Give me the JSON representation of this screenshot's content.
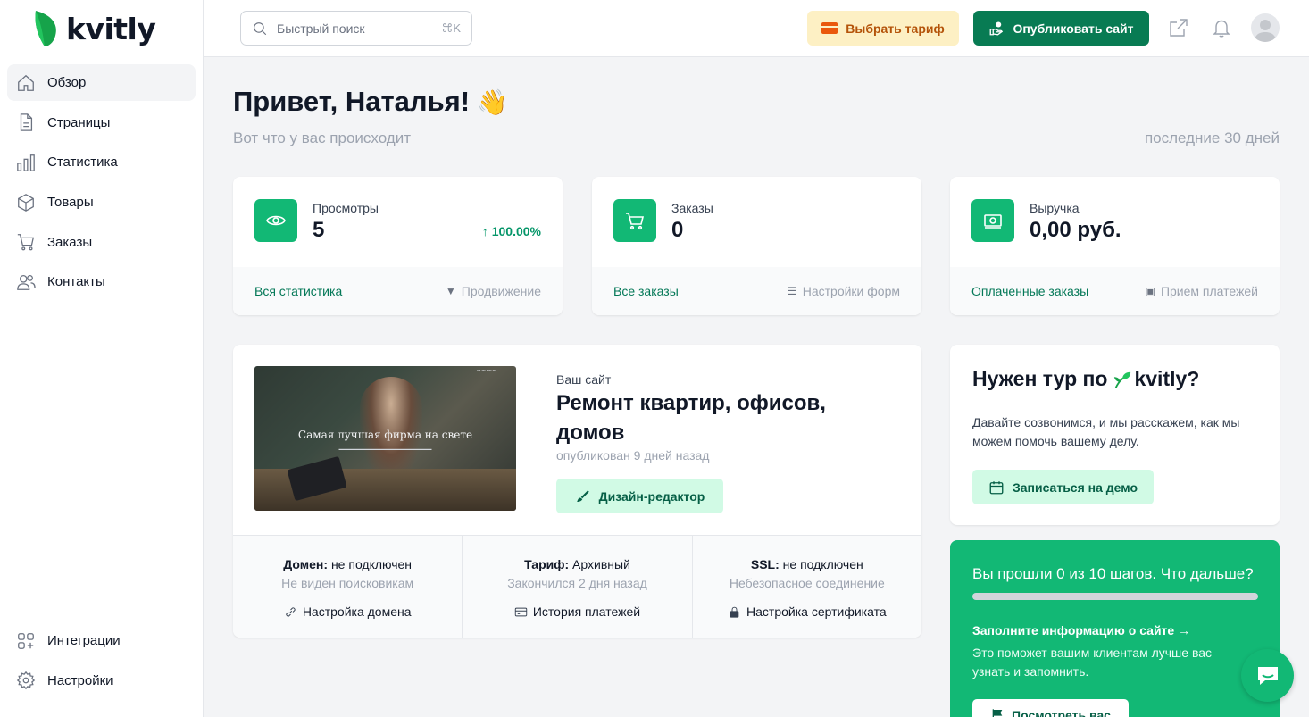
{
  "brand": {
    "name": "kvitly",
    "accent": "#12b875"
  },
  "sidebar": {
    "items": [
      {
        "label": "Обзор",
        "icon": "home-icon"
      },
      {
        "label": "Страницы",
        "icon": "document-icon"
      },
      {
        "label": "Статистика",
        "icon": "bar-chart-icon"
      },
      {
        "label": "Товары",
        "icon": "box-icon"
      },
      {
        "label": "Заказы",
        "icon": "cart-icon"
      },
      {
        "label": "Контакты",
        "icon": "users-icon"
      }
    ],
    "bottom": [
      {
        "label": "Интеграции",
        "icon": "integrations-icon"
      },
      {
        "label": "Настройки",
        "icon": "gear-icon"
      }
    ]
  },
  "header": {
    "search_placeholder": "Быстрый поиск",
    "search_shortcut": "⌘K",
    "tariff_label": "Выбрать тариф",
    "publish_label": "Опубликовать сайт"
  },
  "greeting": {
    "title": "Привет, Наталья!",
    "emoji": "👋",
    "subtitle": "Вот что у вас происходит",
    "period": "последние 30 дней"
  },
  "stats": [
    {
      "label": "Просмотры",
      "value": "5",
      "trend": "↑ 100.00%",
      "link": "Вся статистика",
      "secondary": "Продвижение",
      "icon": "eye-icon"
    },
    {
      "label": "Заказы",
      "value": "0",
      "trend": "",
      "link": "Все заказы",
      "secondary": "Настройки форм",
      "icon": "cart-icon"
    },
    {
      "label": "Выручка",
      "value": "0,00 руб.",
      "trend": "",
      "link": "Оплаченные заказы",
      "secondary": "Прием платежей",
      "icon": "money-icon"
    }
  ],
  "site": {
    "kind": "Ваш сайт",
    "name": "Ремонт квартир, офисов, домов",
    "published": "опубликован 9 дней назад",
    "design_button": "Дизайн-редактор",
    "thumb_title": "Самая лучшая фирма на свете",
    "cells": [
      {
        "key": "Домен:",
        "value": " не подключен",
        "sub": "Не виден поисковикам",
        "action": "Настройка домена"
      },
      {
        "key": "Тариф:",
        "value": " Архивный",
        "sub": "Закончился 2 дня назад",
        "action": "История платежей"
      },
      {
        "key": "SSL:",
        "value": " не подключен",
        "sub": "Небезопасное соединение",
        "action": "Настройка сертификата"
      }
    ]
  },
  "tour": {
    "title_prefix": "Нужен тур по",
    "title_brand": "kvitly?",
    "text": "Давайте созвонимся, и мы расскажем, как мы можем помочь вашему делу.",
    "button": "Записаться на демо"
  },
  "steps": {
    "title": "Вы прошли 0 из 10 шагов. Что дальше?",
    "progress": 0,
    "link": "Заполните информацию о сайте →",
    "desc": "Это поможет вашим клиентам лучше вас узнать и запомнить.",
    "button": "Посмотреть вас"
  }
}
